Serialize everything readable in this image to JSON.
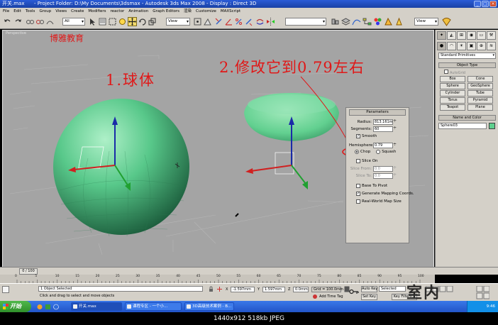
{
  "window": {
    "title_left": "开关.max",
    "title": "- Project Folder: D:\\My Documents\\3dsmax - Autodesk 3ds Max 2008 - Display : Direct 3D"
  },
  "menu": [
    "File",
    "Edit",
    "Tools",
    "Group",
    "Views",
    "Create",
    "Modifiers",
    "reactor",
    "Animation",
    "Graph Editors",
    "渲染",
    "Customize",
    "MAXScript"
  ],
  "toolbar": {
    "filter": "All",
    "view": "View",
    "view2": "View"
  },
  "viewport": {
    "label": "Perspective",
    "annotations": {
      "brand": "博雅教育",
      "sphere_label": "1.球体",
      "instruction": "2.修改它到0.79左右"
    }
  },
  "parameters": {
    "header": "Parameters",
    "radius_label": "Radius:",
    "radius_value": "813.161m",
    "segments_label": "Segments:",
    "segments_value": "60",
    "smooth_label": "Smooth",
    "hemisphere_label": "Hemisphere:",
    "hemisphere_value": "0.79",
    "chop_label": "Chop",
    "squash_label": "Squash",
    "slice_on_label": "Slice On",
    "slice_from_label": "Slice From:",
    "slice_from_value": "0.0",
    "slice_to_label": "Slice To:",
    "slice_to_value": "0.0",
    "base_to_pivot_label": "Base To Pivot",
    "gen_mapping_label": "Generate Mapping Coords.",
    "realworld_label": "Real-World Map Size"
  },
  "command_panel": {
    "category": "Standard Primitives",
    "object_type_header": "Object Type",
    "autogrid_label": "AutoGrid",
    "buttons": [
      "Box",
      "Cone",
      "Sphere",
      "GeoSphere",
      "Cylinder",
      "Tube",
      "Torus",
      "Pyramid",
      "Teapot",
      "Plane"
    ],
    "name_color_header": "Name and Color",
    "object_name": "Sphere03",
    "object_color": "#5ed08e"
  },
  "timeline": {
    "frame": "0 / 100",
    "ticks": [
      "0",
      "5",
      "10",
      "15",
      "20",
      "25",
      "30",
      "35",
      "40",
      "45",
      "50",
      "55",
      "60",
      "65",
      "70",
      "75",
      "80",
      "85",
      "90",
      "95",
      "100"
    ]
  },
  "status": {
    "selection": "1 Object Selected",
    "prompt": "Click and drag to select and move objects",
    "x_label": "X",
    "x_value": "-1.597mm",
    "y_label": "Y",
    "y_value": "1.597mm",
    "z_label": "Z",
    "z_value": "0.0mm",
    "grid": "Grid = 100.0mm",
    "add_time_tag": "Add Time Tag",
    "auto_key": "Auto Key",
    "set_key": "Set Key",
    "selected": "Selected",
    "key_filters": "Key Filters..."
  },
  "taskbar": {
    "start": "开始",
    "tasks": [
      "开关.max",
      "课程专区 - 一个小...",
      "3D高级技术案例 - B..."
    ],
    "clock": "9:46"
  },
  "watermark": "室内",
  "image_info": "1440x912 518kb JPEG"
}
